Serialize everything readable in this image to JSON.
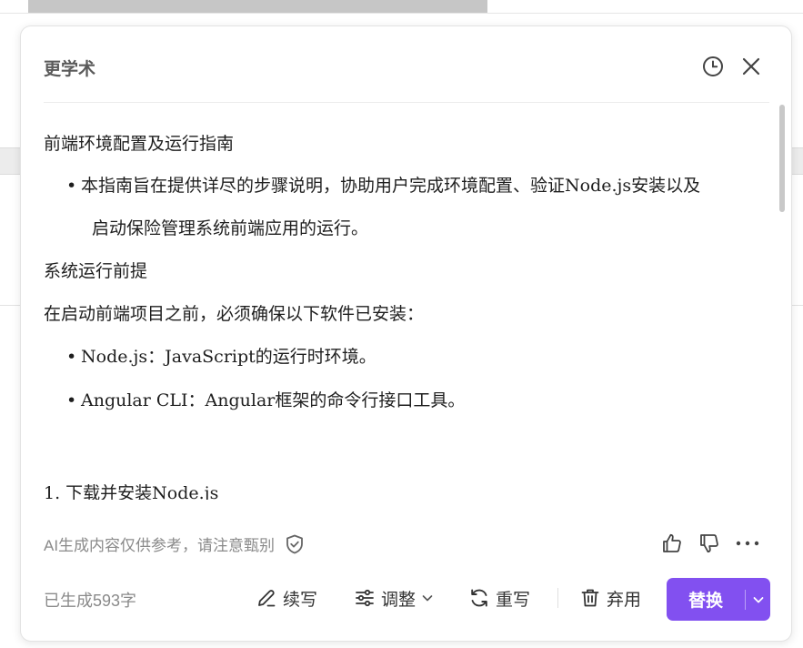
{
  "panel": {
    "title": "更学术",
    "history_icon": "clock-icon",
    "close_icon": "close-icon"
  },
  "content": {
    "heading1": "前端环境配置及运行指南",
    "bullet1_line1": "本指南旨在提供详尽的步骤说明，协助用户完成环境配置、验证Node.js安装以及",
    "bullet1_line2": "启动保险管理系统前端应用的运行。",
    "heading2": "系统运行前提",
    "para1": "在启动前端项目之前，必须确保以下软件已安装：",
    "bullet2": "Node.js：JavaScript的运行时环境。",
    "bullet3": "Angular CLI：Angular框架的命令行接口工具。",
    "step1": "1. 下载并安装Node.js",
    "bullet_symbol": "•"
  },
  "footer": {
    "disclaimer": "AI生成内容仅供参考，请注意甄别",
    "word_count": "已生成593字",
    "continue_label": "续写",
    "adjust_label": "调整",
    "rewrite_label": "重写",
    "discard_label": "弃用",
    "replace_label": "替换"
  },
  "colors": {
    "accent": "#8250f0"
  }
}
